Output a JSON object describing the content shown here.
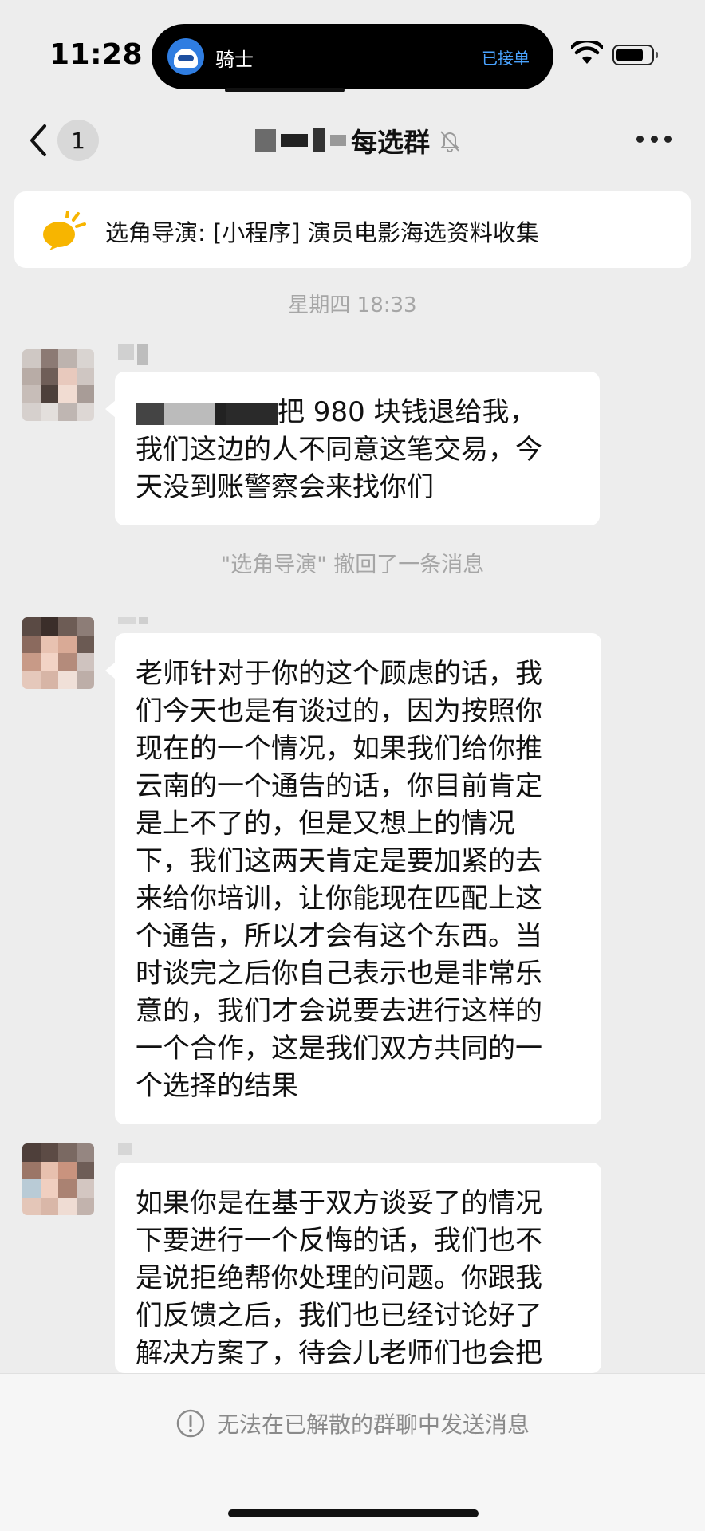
{
  "status_bar": {
    "time": "11:28",
    "island_app_name": "骑士",
    "island_status": "已接单"
  },
  "nav": {
    "unread_count": "1",
    "title_visible": "每选群",
    "back_icon": "chevron-left-icon",
    "mute_icon": "bell-slash-icon",
    "more_icon": "more-dots-icon"
  },
  "notice": {
    "text": "选角导演: [小程序] 演员电影海选资料收集",
    "icon": "megaphone-icon"
  },
  "chat": {
    "timestamp": "星期四 18:33",
    "messages": [
      {
        "lines": [
          "把 980 块钱退给我，",
          "我们这边的人不同意这笔交易，今",
          "天没到账警察会来找你们"
        ]
      },
      {
        "lines": [
          "老师针对于你的这个顾虑的话，我",
          "们今天也是有谈过的，因为按照你",
          "现在的一个情况，如果我们给你推",
          "云南的一个通告的话，你目前肯定",
          "是上不了的，但是又想上的情况",
          "下，我们这两天肯定是要加紧的去",
          "来给你培训，让你能现在匹配上这",
          "个通告，所以才会有这个东西。当",
          "时谈完之后你自己表示也是非常乐",
          "意的，我们才会说要去进行这样的",
          "一个合作，这是我们双方共同的一",
          "个选择的结果"
        ]
      },
      {
        "lines": [
          "如果你是在基于双方谈妥了的情况",
          "下要进行一个反悔的话，我们也不",
          "是说拒绝帮你处理的问题。你跟我",
          "们反馈之后，我们也已经讨论好了",
          "解决方案了，待会儿老师们也会把"
        ]
      }
    ],
    "recall_notice": "\"选角导演\" 撤回了一条消息"
  },
  "bottom": {
    "disabled_message": "无法在已解散的群聊中发送消息",
    "icon": "info-circle-icon"
  },
  "colors": {
    "background": "#ededed",
    "bubble": "#ffffff",
    "island_status": "#4aa3ff",
    "notice_icon": "#f7b500"
  }
}
